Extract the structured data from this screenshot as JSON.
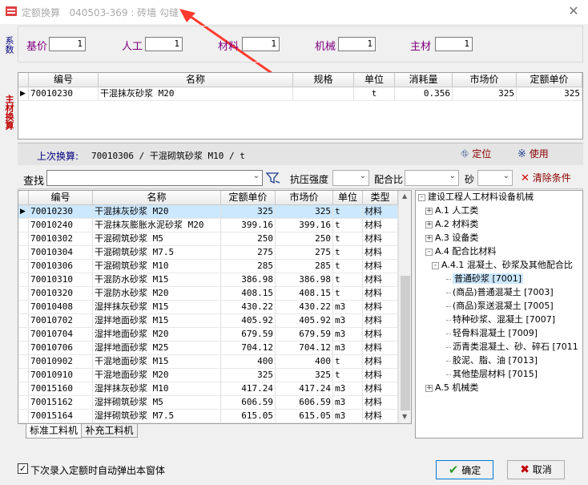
{
  "window": {
    "title": "定额换算",
    "subtitle": "040503-369 : 砖墙 勾缝",
    "close": "✕"
  },
  "side_tabs": [
    "系数",
    "主材换算"
  ],
  "coefficients": [
    {
      "label": "基价",
      "value": "1"
    },
    {
      "label": "人工",
      "value": "1"
    },
    {
      "label": "材料",
      "value": "1"
    },
    {
      "label": "机械",
      "value": "1"
    },
    {
      "label": "主材",
      "value": "1"
    }
  ],
  "main_grid": {
    "headers": [
      "编号",
      "名称",
      "规格",
      "单位",
      "消耗量",
      "市场价",
      "定额单价"
    ],
    "rows": [
      {
        "code": "70010230",
        "name": "干混抹灰砂浆 M20",
        "spec": "",
        "unit": "t",
        "qty": "0.356",
        "market": "325",
        "price": "325"
      }
    ]
  },
  "last_conversion": {
    "label": "上次换算:",
    "value": "70010306 / 干混砌筑砂浆 M10 / t"
  },
  "toolbar": {
    "locate": "定位",
    "use": "使用",
    "search_label": "查找",
    "search_value": "",
    "strength_label": "抗压强度",
    "ratio_label": "配合比",
    "sand_label": "砂",
    "clear_label": "清除条件"
  },
  "material_grid": {
    "headers": [
      "编号",
      "名称",
      "定额单价",
      "市场价",
      "单位",
      "类型"
    ],
    "rows": [
      [
        "70010230",
        "干混抹灰砂浆 M20",
        "325",
        "325",
        "t",
        "材料"
      ],
      [
        "70010240",
        "干混抹灰膨胀水泥砂浆 M20",
        "399.16",
        "399.16",
        "t",
        "材料"
      ],
      [
        "70010302",
        "干混砌筑砂浆 M5",
        "250",
        "250",
        "t",
        "材料"
      ],
      [
        "70010304",
        "干混砌筑砂浆 M7.5",
        "275",
        "275",
        "t",
        "材料"
      ],
      [
        "70010306",
        "干混砌筑砂浆 M10",
        "285",
        "285",
        "t",
        "材料"
      ],
      [
        "70010310",
        "干混防水砂浆 M15",
        "386.98",
        "386.98",
        "t",
        "材料"
      ],
      [
        "70010320",
        "干混防水砂浆 M20",
        "408.15",
        "408.15",
        "t",
        "材料"
      ],
      [
        "70010408",
        "湿拌抹灰砂浆 M15",
        "430.22",
        "430.22",
        "m3",
        "材料"
      ],
      [
        "70010702",
        "湿拌地面砂浆 M15",
        "405.92",
        "405.92",
        "m3",
        "材料"
      ],
      [
        "70010704",
        "湿拌地面砂浆 M20",
        "679.59",
        "679.59",
        "m3",
        "材料"
      ],
      [
        "70010706",
        "湿拌地面砂浆 M25",
        "704.12",
        "704.12",
        "m3",
        "材料"
      ],
      [
        "70010902",
        "干混地面砂浆 M15",
        "400",
        "400",
        "t",
        "材料"
      ],
      [
        "70010910",
        "干混地面砂浆 M20",
        "325",
        "325",
        "t",
        "材料"
      ],
      [
        "70015160",
        "湿拌抹灰砂浆 M10",
        "417.24",
        "417.24",
        "m3",
        "材料"
      ],
      [
        "70015162",
        "湿拌砌筑砂浆 M5",
        "606.59",
        "606.59",
        "m3",
        "材料"
      ],
      [
        "70015164",
        "湿拌砌筑砂浆 M7.5",
        "615.05",
        "615.05",
        "m3",
        "材料"
      ]
    ]
  },
  "tree": {
    "root": "建设工程人工材料设备机械",
    "items": [
      {
        "label": "A.1 人工类",
        "expander": "+"
      },
      {
        "label": "A.2 材料类",
        "expander": "+"
      },
      {
        "label": "A.3 设备类",
        "expander": "+"
      },
      {
        "label": "A.4 配合比材料",
        "expander": "-"
      },
      {
        "label": "A.4.1 混凝土、砂浆及其他配合比",
        "expander": "-"
      },
      {
        "label": "普通砂浆 [7001]",
        "expander": ""
      },
      {
        "label": "(商品)普通混凝土 [7003]",
        "expander": ""
      },
      {
        "label": "(商品)泵送混凝土 [7005]",
        "expander": ""
      },
      {
        "label": "特种砂浆、混凝土 [7007]",
        "expander": ""
      },
      {
        "label": "轻骨料混凝土 [7009]",
        "expander": ""
      },
      {
        "label": "沥青类混凝土、砂、碎石 [7011",
        "expander": ""
      },
      {
        "label": "胶泥、脂、油 [7013]",
        "expander": ""
      },
      {
        "label": "其他垫层材料 [7015]",
        "expander": ""
      },
      {
        "label": "A.5 机械类",
        "expander": "+"
      }
    ]
  },
  "bottom_tabs": [
    "标准工料机",
    "补充工料机"
  ],
  "footer": {
    "auto_popup": "下次录入定额时自动弹出本窗体",
    "ok": "确定",
    "cancel": "取消"
  },
  "colors": {
    "selected_row": "#cce8ff",
    "label_purple": "#800080",
    "accent_red": "#c00000"
  }
}
